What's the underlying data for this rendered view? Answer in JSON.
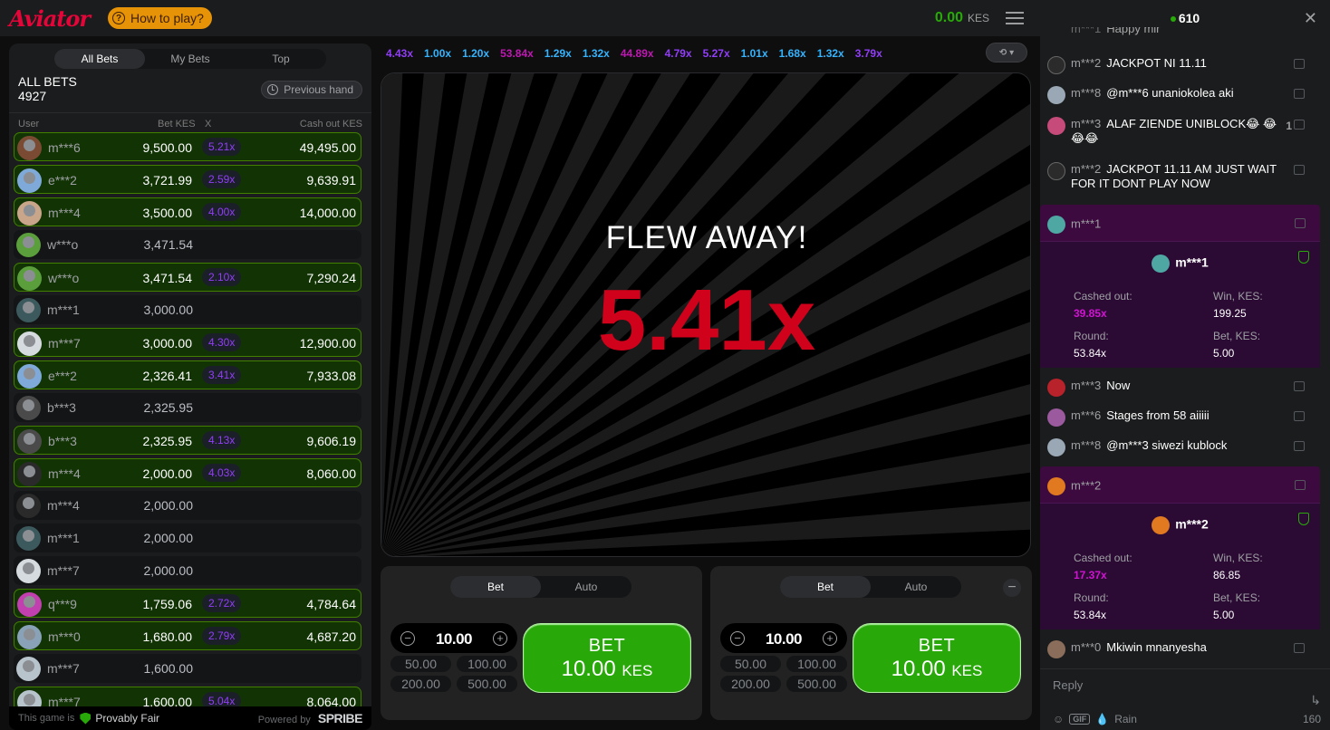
{
  "header": {
    "logo": "Aviator",
    "how_to_play": "How to play?",
    "balance": "0.00",
    "currency": "KES"
  },
  "bets": {
    "tabs": [
      "All Bets",
      "My Bets",
      "Top"
    ],
    "title": "ALL BETS",
    "count": "4927",
    "previous_hand": "Previous hand",
    "columns": {
      "user": "User",
      "bet": "Bet KES",
      "x": "X",
      "cashout": "Cash out KES"
    },
    "rows": [
      {
        "user": "m***6",
        "bet": "9,500.00",
        "mult": "5.21x",
        "cash": "49,495.00",
        "win": true,
        "color": "#7a4b32"
      },
      {
        "user": "e***2",
        "bet": "3,721.99",
        "mult": "2.59x",
        "cash": "9,639.91",
        "win": true,
        "color": "#7ea9d8"
      },
      {
        "user": "m***4",
        "bet": "3,500.00",
        "mult": "4.00x",
        "cash": "14,000.00",
        "win": true,
        "color": "#c9a58a"
      },
      {
        "user": "w***o",
        "bet": "3,471.54",
        "mult": "",
        "cash": "",
        "win": false,
        "color": "#5b9e3c"
      },
      {
        "user": "w***o",
        "bet": "3,471.54",
        "mult": "2.10x",
        "cash": "7,290.24",
        "win": true,
        "color": "#5b9e3c"
      },
      {
        "user": "m***1",
        "bet": "3,000.00",
        "mult": "",
        "cash": "",
        "win": false,
        "color": "#3c5a5e"
      },
      {
        "user": "m***7",
        "bet": "3,000.00",
        "mult": "4.30x",
        "cash": "12,900.00",
        "win": true,
        "color": "#d6dbe0"
      },
      {
        "user": "e***2",
        "bet": "2,326.41",
        "mult": "3.41x",
        "cash": "7,933.08",
        "win": true,
        "color": "#7ea9d8"
      },
      {
        "user": "b***3",
        "bet": "2,325.95",
        "mult": "",
        "cash": "",
        "win": false,
        "color": "#4a4a4a"
      },
      {
        "user": "b***3",
        "bet": "2,325.95",
        "mult": "4.13x",
        "cash": "9,606.19",
        "win": true,
        "color": "#4a4a4a"
      },
      {
        "user": "m***4",
        "bet": "2,000.00",
        "mult": "4.03x",
        "cash": "8,060.00",
        "win": true,
        "color": "#2a2a2a"
      },
      {
        "user": "m***4",
        "bet": "2,000.00",
        "mult": "",
        "cash": "",
        "win": false,
        "color": "#2a2a2a"
      },
      {
        "user": "m***1",
        "bet": "2,000.00",
        "mult": "",
        "cash": "",
        "win": false,
        "color": "#3c5a5e"
      },
      {
        "user": "m***7",
        "bet": "2,000.00",
        "mult": "",
        "cash": "",
        "win": false,
        "color": "#d6dbe0"
      },
      {
        "user": "q***9",
        "bet": "1,759.06",
        "mult": "2.72x",
        "cash": "4,784.64",
        "win": true,
        "color": "#c23fb0"
      },
      {
        "user": "m***0",
        "bet": "1,680.00",
        "mult": "2.79x",
        "cash": "4,687.20",
        "win": true,
        "color": "#8aa2b8"
      },
      {
        "user": "m***7",
        "bet": "1,600.00",
        "mult": "",
        "cash": "",
        "win": false,
        "color": "#b8c4cc"
      },
      {
        "user": "m***7",
        "bet": "1,600.00",
        "mult": "5.04x",
        "cash": "8,064.00",
        "win": true,
        "color": "#b8c4cc"
      }
    ]
  },
  "footer": {
    "this_game_is": "This game is",
    "provably_fair": "Provably Fair",
    "powered_by": "Powered by",
    "brand": "SPRIBE"
  },
  "history": [
    {
      "v": "4.43x",
      "c": "#913ef8"
    },
    {
      "v": "1.00x",
      "c": "#34b4ff"
    },
    {
      "v": "1.20x",
      "c": "#34b4ff"
    },
    {
      "v": "53.84x",
      "c": "#c017b4"
    },
    {
      "v": "1.29x",
      "c": "#34b4ff"
    },
    {
      "v": "1.32x",
      "c": "#34b4ff"
    },
    {
      "v": "44.89x",
      "c": "#c017b4"
    },
    {
      "v": "4.79x",
      "c": "#913ef8"
    },
    {
      "v": "5.27x",
      "c": "#913ef8"
    },
    {
      "v": "1.01x",
      "c": "#34b4ff"
    },
    {
      "v": "1.68x",
      "c": "#34b4ff"
    },
    {
      "v": "1.32x",
      "c": "#34b4ff"
    },
    {
      "v": "3.79x",
      "c": "#913ef8"
    }
  ],
  "stage": {
    "flew_away": "FLEW AWAY!",
    "crash": "5.41x"
  },
  "panels": [
    {
      "tabs": [
        "Bet",
        "Auto"
      ],
      "amount": "10.00",
      "quick": [
        "50.00",
        "100.00",
        "200.00",
        "500.00"
      ],
      "bet_label": "BET",
      "bet_amount": "10.00",
      "bet_currency": "KES"
    },
    {
      "tabs": [
        "Bet",
        "Auto"
      ],
      "amount": "10.00",
      "quick": [
        "50.00",
        "100.00",
        "200.00",
        "500.00"
      ],
      "bet_label": "BET",
      "bet_amount": "10.00",
      "bet_currency": "KES"
    }
  ],
  "chat": {
    "online": "610",
    "reply_placeholder": "Reply",
    "gif": "GIF",
    "rain": "Rain",
    "char_count": "160",
    "messages": [
      {
        "user": "m***2",
        "text": "JACKPOT NI 11.11",
        "color": "#2b2b2b"
      },
      {
        "user": "m***8",
        "text": "@m***6 unaniokolea aki",
        "color": "#9aa8b5"
      },
      {
        "user": "m***3",
        "text": "ALAF ZIENDE UNIBLOCK😂 😂😂😂",
        "color": "#c64a7a",
        "likes": "1"
      },
      {
        "user": "m***2",
        "text": "JACKPOT 11.11 AM JUST WAIT FOR IT DONT PLAY NOW",
        "color": "#2b2b2b"
      },
      {
        "user": "m***3",
        "text": "Now",
        "color": "#b8222a"
      },
      {
        "user": "m***6",
        "text": "Stages from 58 aiiiii",
        "color": "#9b5a9e"
      },
      {
        "user": "m***8",
        "text": "@m***3 siwezi kublock",
        "color": "#9aa8b5"
      },
      {
        "user": "m***0",
        "text": "Mkiwin mnanyesha",
        "color": "#8a6d5a"
      }
    ],
    "cards": [
      {
        "user": "m***1",
        "cashed_out_label": "Cashed out:",
        "cashed_out": "39.85x",
        "win_label": "Win, KES:",
        "win": "199.25",
        "round_label": "Round:",
        "round": "53.84x",
        "bet_label": "Bet, KES:",
        "bet": "5.00",
        "color": "#4fa7a4"
      },
      {
        "user": "m***2",
        "cashed_out_label": "Cashed out:",
        "cashed_out": "17.37x",
        "win_label": "Win, KES:",
        "win": "86.85",
        "round_label": "Round:",
        "round": "53.84x",
        "bet_label": "Bet, KES:",
        "bet": "5.00",
        "color": "#e0791f"
      }
    ],
    "partial_top": "Happy mir"
  }
}
